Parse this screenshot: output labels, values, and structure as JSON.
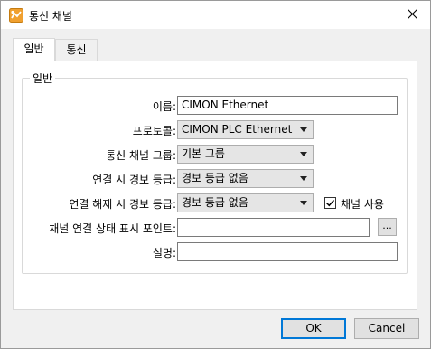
{
  "window": {
    "title": "통신 채널"
  },
  "tabs": [
    {
      "label": "일반",
      "active": true
    },
    {
      "label": "통신",
      "active": false
    }
  ],
  "group": {
    "title": "일반"
  },
  "fields": {
    "name": {
      "label": "이름:",
      "value": "CIMON Ethernet"
    },
    "protocol": {
      "label": "프로토콜:",
      "value": "CIMON PLC Ethernet"
    },
    "channel_group": {
      "label": "통신 채널 그룹:",
      "value": "기본 그룹"
    },
    "connect_alarm": {
      "label": "연결 시 경보 등급:",
      "value": "경보 등급 없음"
    },
    "disconnect_alarm": {
      "label": "연결 해제 시 경보 등급:",
      "value": "경보 등급 없음"
    },
    "use_channel": {
      "label": "채널 사용",
      "checked": true
    },
    "status_point": {
      "label": "채널 연결 상태 표시 포인트:",
      "value": "",
      "browse_label": "..."
    },
    "description": {
      "label": "설명:",
      "value": ""
    }
  },
  "buttons": {
    "ok": "OK",
    "cancel": "Cancel"
  },
  "colors": {
    "accent": "#0078d7",
    "icon_orange": "#f0a030"
  }
}
